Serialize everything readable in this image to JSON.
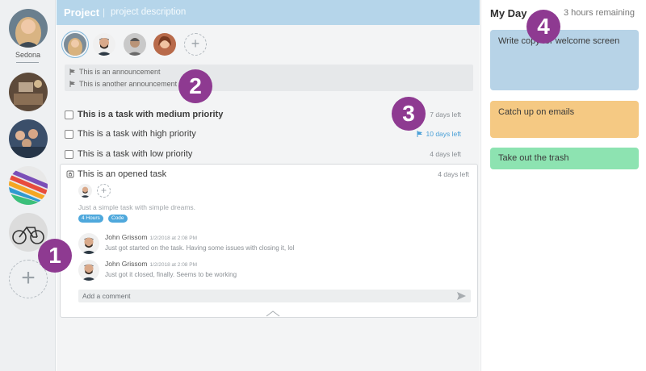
{
  "sidebar": {
    "user_name": "Sedona",
    "projects": [
      "photo-1",
      "photo-2",
      "photo-3",
      "photo-4",
      "photo-5"
    ],
    "add_icon": "plus-icon"
  },
  "project": {
    "title": "Project",
    "separator": "|",
    "description": "project description"
  },
  "members": {
    "add_icon": "plus-icon"
  },
  "announcements": [
    {
      "text": "This is an announcement",
      "icon": "flag-icon"
    },
    {
      "text": "This is another announcement",
      "icon": "flag-icon"
    }
  ],
  "tasks": [
    {
      "label": "This is a task with medium priority",
      "due": "7 days left",
      "flag": "gray"
    },
    {
      "label": "This is a task with high priority",
      "due": "10 days left",
      "flag": "blue"
    },
    {
      "label": "This is a task with low priority",
      "due": "4 days left",
      "flag": "none"
    }
  ],
  "opened_task": {
    "title": "This is an opened task",
    "due": "4 days left",
    "description": "Just a simple task with simple dreams.",
    "tags": [
      "4 Hours",
      "Code"
    ],
    "comments": [
      {
        "author": "John Grissom",
        "time": "1/2/2018 at 2:08 PM",
        "text": "Just got started on the task. Having some issues with closing it, lol"
      },
      {
        "author": "John Grissom",
        "time": "1/2/2018 at 2:08 PM",
        "text": "Just got it closed, finally. Seems to be working"
      }
    ],
    "comment_placeholder": "Add a comment"
  },
  "my_day": {
    "title": "My Day",
    "remaining": "3 hours remaining",
    "cards": [
      {
        "text": "Write copy for welcome screen",
        "color": "#b7d3e7"
      },
      {
        "text": "Catch up on emails",
        "color": "#f5c983"
      },
      {
        "text": "Take out the trash",
        "color": "#8de3b1"
      }
    ]
  },
  "markers": [
    "1",
    "2",
    "3",
    "4"
  ],
  "colors": {
    "accent": "#4ea8dc",
    "header": "#b5d5ea",
    "marker": "#8e3a91"
  }
}
